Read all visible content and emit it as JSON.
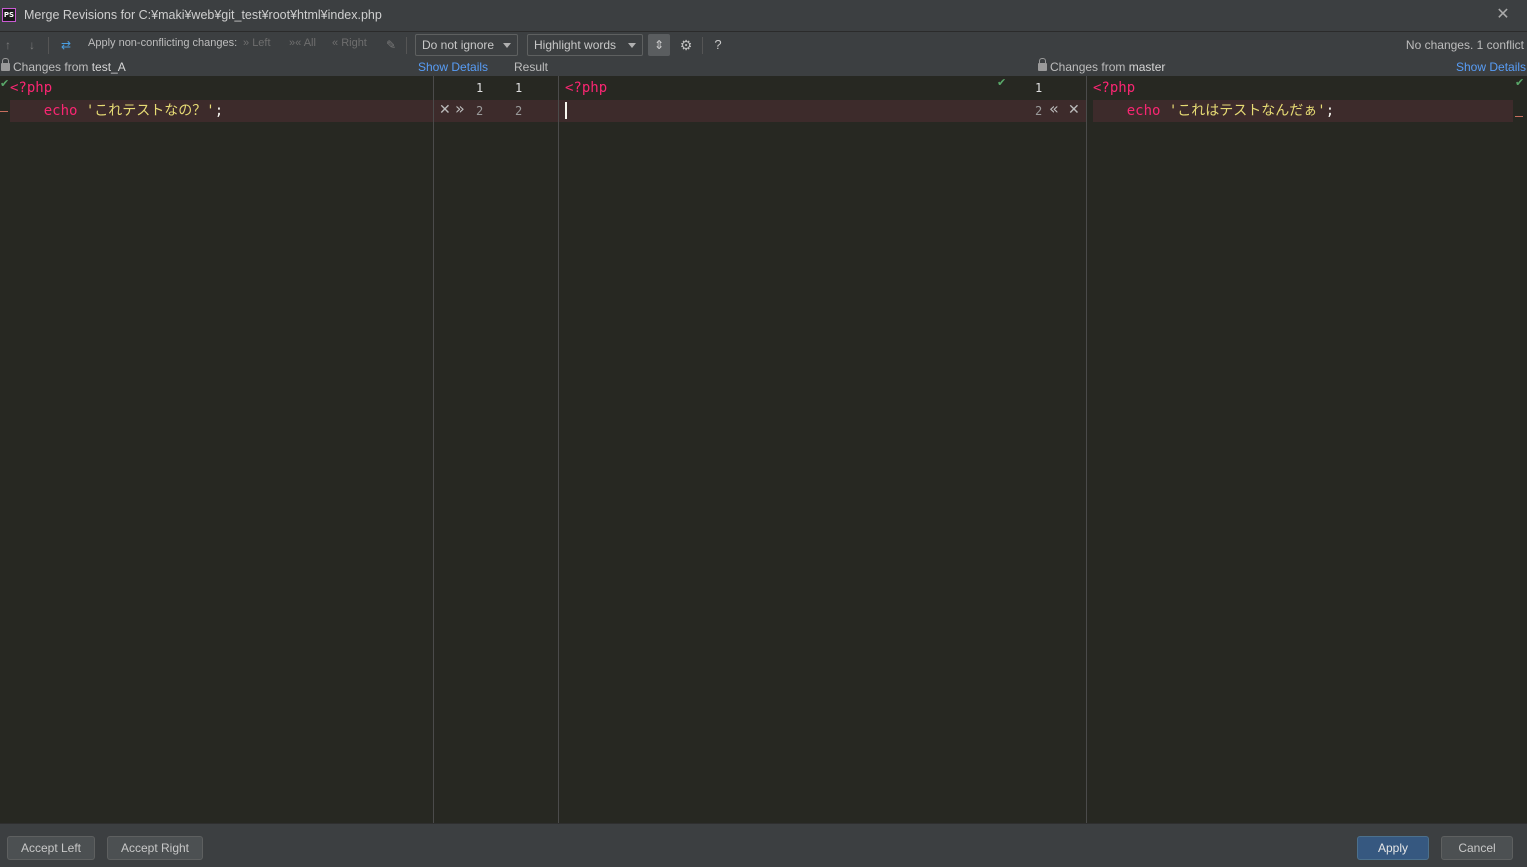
{
  "window": {
    "title": "Merge Revisions for C:¥maki¥web¥git_test¥root¥html¥index.php",
    "app_icon": "PS",
    "close_icon": "✕"
  },
  "toolbar": {
    "prev_icon": "↑",
    "next_icon": "↓",
    "magic_icon": "⇄",
    "apply_label": "Apply non-conflicting changes:",
    "left_label": "Left",
    "all_label": "All",
    "right_label": "Right",
    "resolve_icon": "✎",
    "ignore_combo": "Do not ignore",
    "highlight_combo": "Highlight words",
    "sync_icon": "⇕",
    "settings_icon": "⚙",
    "help_icon": "?",
    "status": "No changes. 1 conflict"
  },
  "headers": {
    "left_prefix": "Changes from",
    "left_branch": "test_A",
    "left_details": "Show Details",
    "result": "Result",
    "right_prefix": "Changes from",
    "right_branch": "master",
    "right_details": "Show Details"
  },
  "left_pane": {
    "lines": [
      {
        "number": "1",
        "tokens": [
          {
            "type": "kw",
            "text": "<?php"
          }
        ]
      },
      {
        "number": "2",
        "tokens": [
          {
            "type": "kw",
            "text": "    echo "
          },
          {
            "type": "str",
            "text": "'これテストなの？'"
          },
          {
            "type": "plain",
            "text": ";"
          }
        ]
      }
    ]
  },
  "middle_gutter": {
    "left_numbers": [
      "1",
      "2"
    ],
    "result_numbers": [
      "1",
      "2"
    ],
    "reject_icon": "✕",
    "accept_left_icon": "»"
  },
  "result_pane": {
    "lines": [
      {
        "number": "1",
        "tokens": [
          {
            "type": "kw",
            "text": "<?php"
          }
        ]
      },
      {
        "number": "2",
        "tokens": []
      }
    ]
  },
  "right_gutter": {
    "numbers": [
      "1",
      "2"
    ],
    "accept_right_icon": "«",
    "reject_icon": "✕"
  },
  "right_pane": {
    "lines": [
      {
        "number": "1",
        "tokens": [
          {
            "type": "kw",
            "text": "<?php"
          }
        ]
      },
      {
        "number": "2",
        "tokens": [
          {
            "type": "kw",
            "text": "    echo "
          },
          {
            "type": "str",
            "text": "'これはテストなんだぁ'"
          },
          {
            "type": "plain",
            "text": ";"
          }
        ]
      }
    ]
  },
  "footer": {
    "accept_left": "Accept Left",
    "accept_right": "Accept Right",
    "apply": "Apply",
    "cancel": "Cancel"
  },
  "colors": {
    "editor_bg": "#272822",
    "chrome_bg": "#3c3f41",
    "keyword": "#f92672",
    "string": "#e6db74",
    "conflict_bg": "#3d2b2b",
    "link": "#589df6",
    "check": "#59a869",
    "primary_button": "#365880"
  }
}
